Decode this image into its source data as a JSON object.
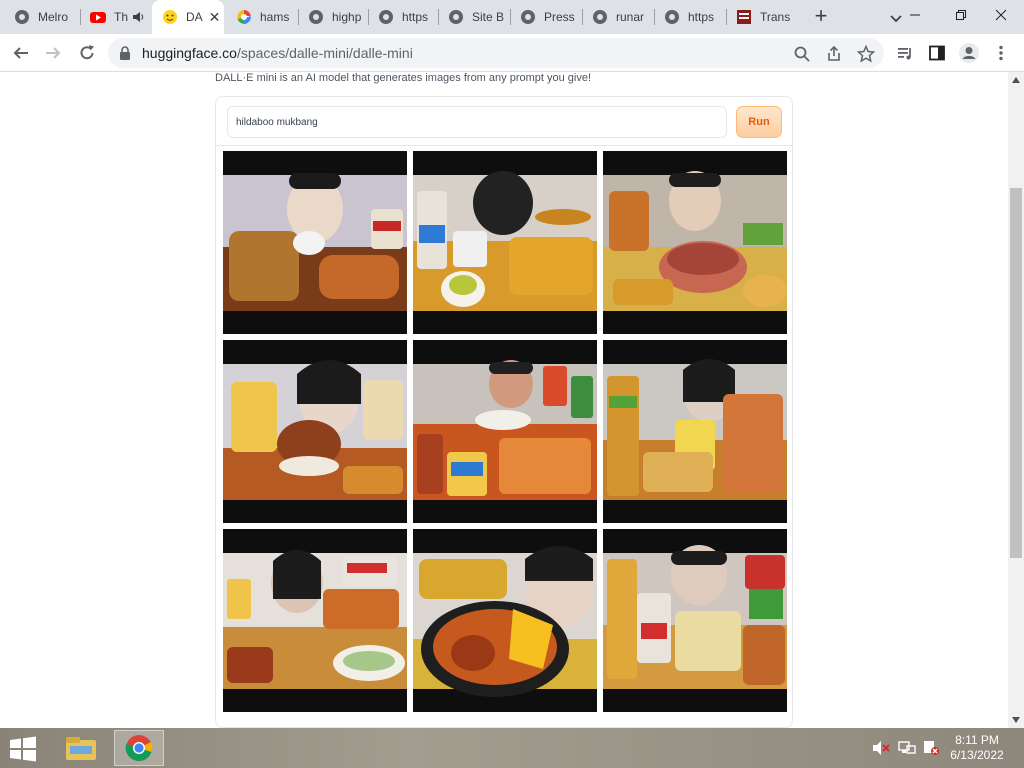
{
  "browser": {
    "tabs": [
      {
        "label": "Melro",
        "icon": "globe-icon"
      },
      {
        "label": "Th",
        "icon": "youtube-icon",
        "audio": true
      },
      {
        "label": "DA",
        "icon": "hugging-face-icon",
        "active": true
      },
      {
        "label": "hams",
        "icon": "google-icon"
      },
      {
        "label": "highp",
        "icon": "globe-icon"
      },
      {
        "label": "https",
        "icon": "globe-icon"
      },
      {
        "label": "Site B",
        "icon": "globe-icon"
      },
      {
        "label": "Press",
        "icon": "globe-icon"
      },
      {
        "label": "runar",
        "icon": "globe-icon"
      },
      {
        "label": "https",
        "icon": "globe-icon"
      },
      {
        "label": "Trans",
        "icon": "document-icon"
      }
    ],
    "url": {
      "host": "huggingface.co",
      "path": "/spaces/dalle-mini/dalle-mini"
    },
    "colors": {
      "tabstrip": "#dee1e6",
      "omnibox": "#f1f3f4"
    }
  },
  "page": {
    "intro": "DALL·E mini is an AI model that generates images from any prompt you give!",
    "prompt_value": "hildaboo mukbang",
    "run_label": "Run",
    "images_count": 9,
    "accent": "#ea580c"
  },
  "taskbar": {
    "time": "8:11 PM",
    "date": "6/13/2022"
  }
}
